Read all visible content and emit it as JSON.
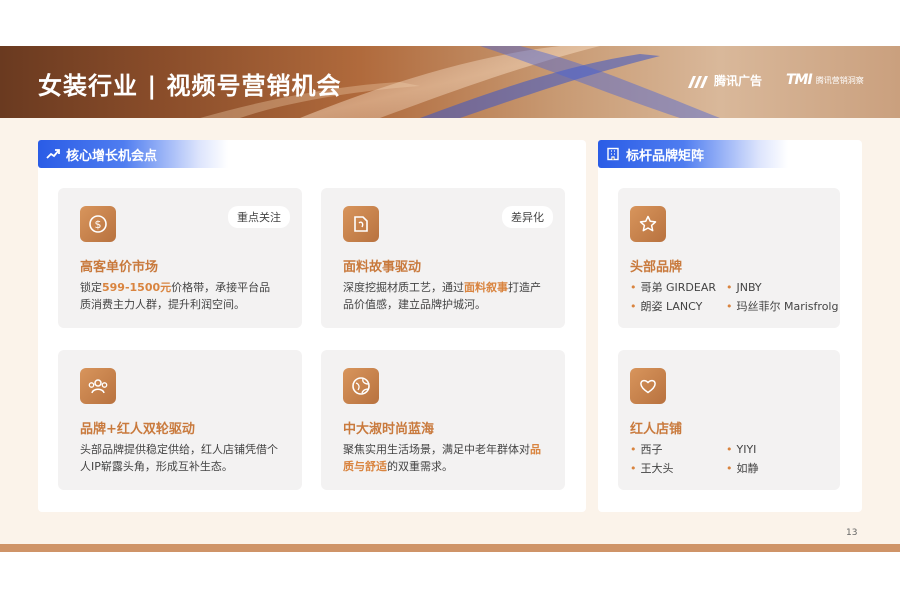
{
  "header": {
    "title": "女装行业 | 视频号营销机会",
    "logo_tencent_ads": "腾讯广告",
    "logo_tmi_mark": "TMI",
    "logo_tmi_text": "腾讯营销洞察"
  },
  "left_section": {
    "title": "核心增长机会点",
    "cards": [
      {
        "title": "高客单价市场",
        "tag": "重点关注",
        "desc_pre": "锁定",
        "desc_hl": "599-1500元",
        "desc_post": "价格带，承接平台品质消费主力人群，提升利润空间。"
      },
      {
        "title": "面料故事驱动",
        "tag": "差异化",
        "desc_pre": "深度挖掘材质工艺，通过",
        "desc_hl": "面料叙事",
        "desc_post": "打造产品价值感，建立品牌护城河。"
      },
      {
        "title": "品牌+红人双轮驱动",
        "desc": "头部品牌提供稳定供给，红人店铺凭借个人IP崭露头角，形成互补生态。"
      },
      {
        "title": "中大淑时尚蓝海",
        "desc_pre": "聚焦实用生活场景，满足中老年群体对",
        "desc_hl": "品质与舒适",
        "desc_post": "的双重需求。"
      }
    ]
  },
  "right_section": {
    "title": "标杆品牌矩阵",
    "cards": [
      {
        "title": "头部品牌",
        "items": [
          "哥弟 GIRDEAR",
          "JNBY",
          "朗姿 LANCY",
          "玛丝菲尔 Marisfrolg"
        ]
      },
      {
        "title": "红人店铺",
        "items": [
          "西子",
          "YIYI",
          "王大头",
          "如静"
        ]
      }
    ]
  },
  "footer": {
    "page_number": "13"
  },
  "colors": {
    "accent": "#c97a3d",
    "highlight": "#d9843f",
    "section_blue": "#2a5ce6",
    "footer_bar": "#cf9468"
  },
  "icons": [
    "trend-up-icon",
    "building-icon",
    "dollar-coin-icon",
    "fabric-icon",
    "people-group-icon",
    "globe-icon",
    "star-icon",
    "heart-icon",
    "bullet-dot"
  ]
}
